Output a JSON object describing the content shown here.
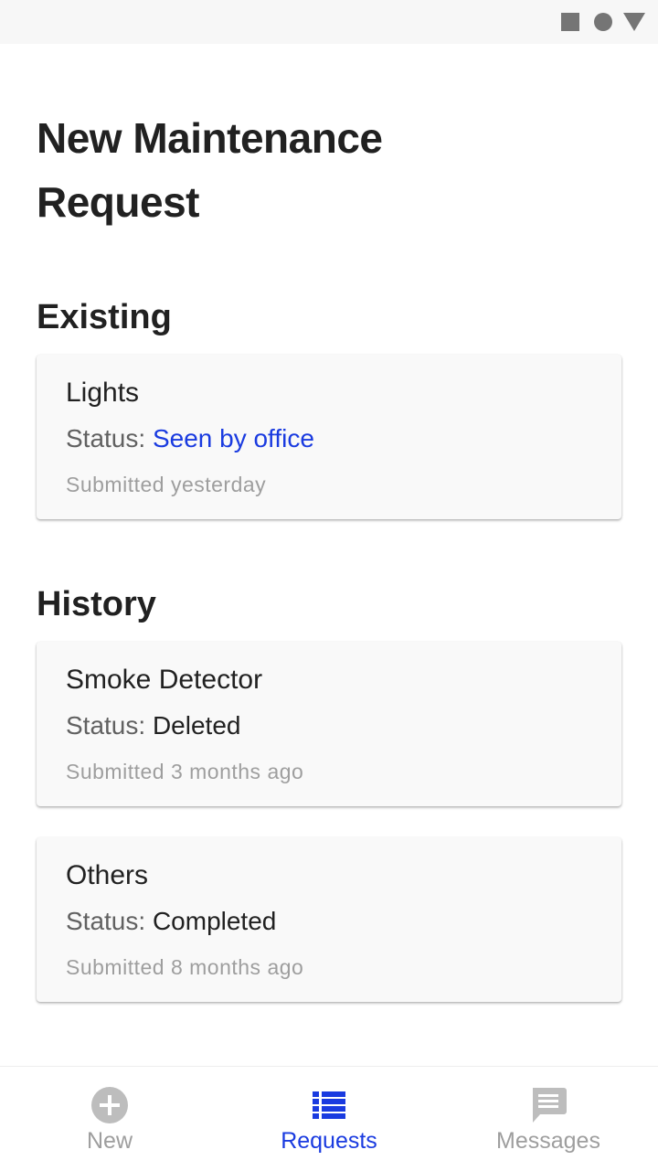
{
  "colors": {
    "accent": "#1a3be0",
    "text_primary": "#212121",
    "text_secondary": "#616161",
    "text_muted": "#9e9e9e",
    "icon_inactive": "#bdbdbd"
  },
  "status_bar": {
    "icons": [
      "square-icon",
      "circle-icon",
      "triangle-icon"
    ]
  },
  "header": {
    "title": "New Maintenance Request"
  },
  "existing": {
    "heading": "Existing",
    "items": [
      {
        "title": "Lights",
        "status_label": "Status:",
        "status_value": "Seen by office",
        "submitted": "Submitted yesterday"
      }
    ]
  },
  "history": {
    "heading": "History",
    "items": [
      {
        "title": "Smoke Detector",
        "status_label": "Status:",
        "status_value": "Deleted",
        "submitted": "Submitted 3 months ago"
      },
      {
        "title": "Others",
        "status_label": "Status:",
        "status_value": "Completed",
        "submitted": "Submitted 8 months ago"
      }
    ]
  },
  "bottom_nav": {
    "selected": "Requests",
    "items": [
      {
        "label": "New",
        "icon": "add-circle-icon"
      },
      {
        "label": "Requests",
        "icon": "list-icon"
      },
      {
        "label": "Messages",
        "icon": "message-icon"
      }
    ]
  }
}
